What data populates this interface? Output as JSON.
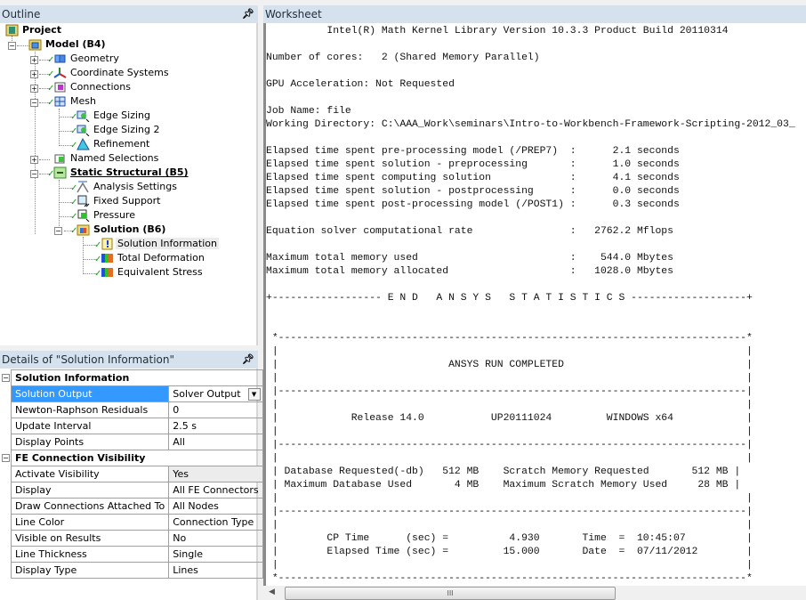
{
  "outline": {
    "title": "Outline",
    "pin_icon": "pin-icon",
    "tree": [
      {
        "label": "Project",
        "icon": "project-icon",
        "bold": true
      },
      {
        "label": "Model (B4)",
        "icon": "model-folder-icon",
        "bold": true
      },
      {
        "label": "Geometry",
        "icon": "geometry-icon"
      },
      {
        "label": "Coordinate Systems",
        "icon": "coordinate-systems-icon"
      },
      {
        "label": "Connections",
        "icon": "connections-icon"
      },
      {
        "label": "Mesh",
        "icon": "mesh-icon"
      },
      {
        "label": "Edge Sizing",
        "icon": "edge-sizing-icon"
      },
      {
        "label": "Edge Sizing 2",
        "icon": "edge-sizing-icon"
      },
      {
        "label": "Refinement",
        "icon": "refinement-icon"
      },
      {
        "label": "Named Selections",
        "icon": "named-selections-icon"
      },
      {
        "label": "Static Structural (B5)",
        "icon": "static-structural-icon",
        "bold": true,
        "underline": true
      },
      {
        "label": "Analysis Settings",
        "icon": "analysis-settings-icon"
      },
      {
        "label": "Fixed Support",
        "icon": "fixed-support-icon"
      },
      {
        "label": "Pressure",
        "icon": "pressure-icon"
      },
      {
        "label": "Solution (B6)",
        "icon": "solution-folder-icon",
        "bold": true
      },
      {
        "label": "Solution Information",
        "icon": "solution-information-icon",
        "selected": true
      },
      {
        "label": "Total Deformation",
        "icon": "result-icon"
      },
      {
        "label": "Equivalent Stress",
        "icon": "result-icon"
      }
    ]
  },
  "details": {
    "title": "Details of \"Solution Information\"",
    "categories": [
      {
        "name": "Solution Information",
        "rows": [
          {
            "name": "Solution Output",
            "value": "Solver Output",
            "selected": true,
            "dropdown": true
          },
          {
            "name": "Newton-Raphson Residuals",
            "value": "0"
          },
          {
            "name": "Update Interval",
            "value": "2.5 s"
          },
          {
            "name": "Display Points",
            "value": "All"
          }
        ]
      },
      {
        "name": "FE Connection Visibility",
        "rows": [
          {
            "name": "Activate Visibility",
            "value": "Yes",
            "readonly": true
          },
          {
            "name": "Display",
            "value": "All FE Connectors"
          },
          {
            "name": "Draw Connections Attached To",
            "value": "All Nodes"
          },
          {
            "name": "Line Color",
            "value": "Connection Type"
          },
          {
            "name": "Visible on Results",
            "value": "No"
          },
          {
            "name": "Line Thickness",
            "value": "Single"
          },
          {
            "name": "Display Type",
            "value": "Lines"
          }
        ]
      }
    ]
  },
  "worksheet": {
    "title": "Worksheet",
    "lines": [
      "          Intel(R) Math Kernel Library Version 10.3.3 Product Build 20110314",
      "",
      "Number of cores:   2 (Shared Memory Parallel)",
      "",
      "GPU Acceleration: Not Requested",
      "",
      "Job Name: file",
      "Working Directory: C:\\AAA_Work\\seminars\\Intro-to-Workbench-Framework-Scripting-2012_03_",
      "",
      "Elapsed time spent pre-processing model (/PREP7)  :      2.1 seconds",
      "Elapsed time spent solution - preprocessing       :      1.0 seconds",
      "Elapsed time spent computing solution             :      4.1 seconds",
      "Elapsed time spent solution - postprocessing      :      0.0 seconds",
      "Elapsed time spent post-processing model (/POST1) :      0.3 seconds",
      "",
      "Equation solver computational rate                :   2762.2 Mflops",
      "",
      "Maximum total memory used                         :    544.0 Mbytes",
      "Maximum total memory allocated                    :   1028.0 Mbytes",
      "",
      "+------------------ E N D   A N S Y S   S T A T I S T I C S -------------------+",
      "",
      "",
      " *-----------------------------------------------------------------------------*",
      " |                                                                             |",
      " |                            ANSYS RUN COMPLETED                              |",
      " |                                                                             |",
      " |-----------------------------------------------------------------------------|",
      " |                                                                             |",
      " |            Release 14.0           UP20111024         WINDOWS x64            |",
      " |                                                                             |",
      " |-----------------------------------------------------------------------------|",
      " |                                                                             |",
      " | Database Requested(-db)   512 MB    Scratch Memory Requested       512 MB |",
      " | Maximum Database Used       4 MB    Maximum Scratch Memory Used     28 MB |",
      " |                                                                             |",
      " |-----------------------------------------------------------------------------|",
      " |                                                                             |",
      " |        CP Time      (sec) =          4.930       Time  =  10:45:07          |",
      " |        Elapsed Time (sec) =         15.000       Date  =  07/11/2012        |",
      " |                                                                             |",
      " *-----------------------------------------------------------------------------*"
    ],
    "scrollbar_grip": "III"
  }
}
